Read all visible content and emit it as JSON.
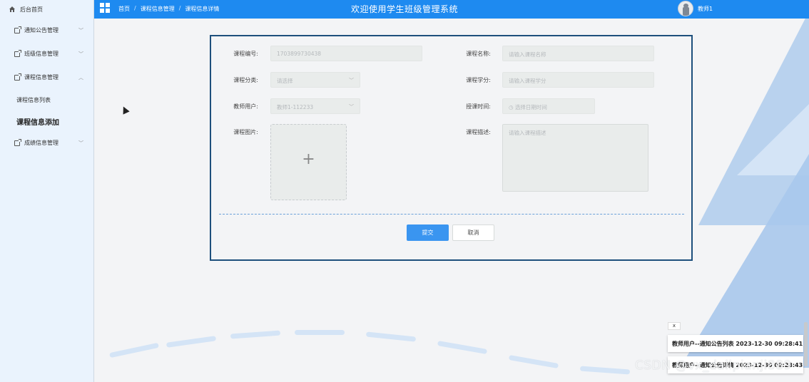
{
  "header": {
    "home_label": "后台首页",
    "breadcrumb": [
      "首页",
      "课程信息管理",
      "课程信息详情"
    ],
    "breadcrumb_sep": "/",
    "title": "欢迎使用学生班级管理系统",
    "user_name": "教师1"
  },
  "sidebar": {
    "items": [
      {
        "label": "通知公告管理",
        "chevron": "﹀"
      },
      {
        "label": "班级信息管理",
        "chevron": "﹀"
      },
      {
        "label": "课程信息管理",
        "chevron": "︿"
      },
      {
        "label": "成绩信息管理",
        "chevron": "﹀"
      }
    ],
    "sub_items": [
      {
        "label": "课程信息列表"
      },
      {
        "label": "课程信息添加"
      }
    ]
  },
  "form": {
    "course_no_label": "课程编号:",
    "course_no_value": "1703899730438",
    "course_name_label": "课程名称:",
    "course_name_placeholder": "请输入课程名称",
    "category_label": "课程分类:",
    "category_placeholder": "请选择",
    "credit_label": "课程学分:",
    "credit_placeholder": "请输入课程学分",
    "teacher_label": "教师用户:",
    "teacher_value": "教师1-112233",
    "time_label": "授课时间:",
    "time_placeholder": "选择日期时间",
    "image_label": "课程图片:",
    "upload_plus": "+",
    "desc_label": "课程描述:",
    "desc_placeholder": "请输入课程描述",
    "submit_label": "提交",
    "cancel_label": "取消"
  },
  "notifications": {
    "close_label": "x",
    "items": [
      {
        "text": "教师用户--通知公告列表 2023-12-30 09:28:41"
      },
      {
        "text": "教师用户--通知公告详情 2023-12-30 09:28:43"
      }
    ]
  },
  "watermark": "CSDN @vx_dailpianji889",
  "icons": {
    "home": "home-icon",
    "grid": "grid-icon",
    "menu": "document-icon",
    "clock": "clock-icon",
    "caret": "chevron-down-icon"
  },
  "colors": {
    "primary": "#1e8af0",
    "sidebar_bg": "#eaf3fd",
    "card_border": "#1d4f7c",
    "submit_bg": "#3a95f0"
  }
}
